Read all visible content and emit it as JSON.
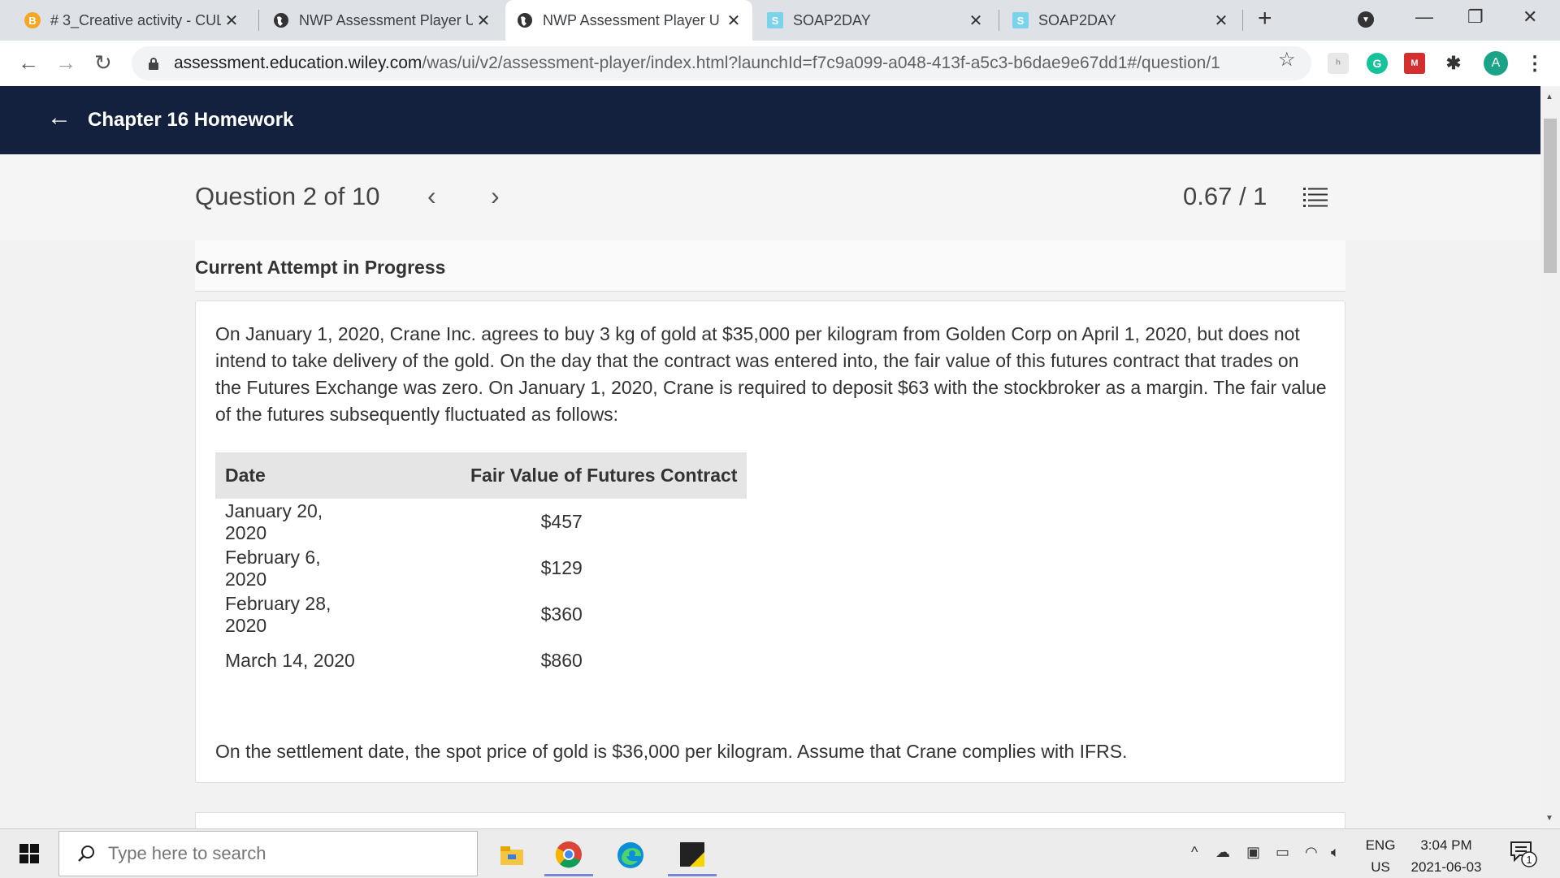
{
  "browser": {
    "tabs": [
      {
        "title": "# 3_Creative activity - CUL",
        "favicon": "b-badge-icon",
        "active": false
      },
      {
        "title": "NWP Assessment Player U",
        "favicon": "globe-icon",
        "active": false
      },
      {
        "title": "NWP Assessment Player U",
        "favicon": "globe-icon",
        "active": true
      },
      {
        "title": "SOAP2DAY",
        "favicon": "s-badge-icon",
        "active": false
      },
      {
        "title": "SOAP2DAY",
        "favicon": "s-badge-icon",
        "active": false
      }
    ],
    "favicon_letters": {
      "b": "B",
      "s": "S"
    },
    "close_glyph": "✕",
    "new_tab_glyph": "+",
    "url_host": "assessment.education.wiley.com",
    "url_path": "/was/ui/v2/assessment-player/index.html?launchId=f7c9a099-a048-413f-a5c3-b6dae9e67dd1#/question/1",
    "profile_initial": "A",
    "colors": {
      "tab_strip": "#dee1e6",
      "header": "#13213f",
      "grammarly": "#15c39a"
    }
  },
  "header": {
    "title": "Chapter 16 Homework"
  },
  "question_nav": {
    "label": "Question 2 of 10",
    "score": "0.67 / 1"
  },
  "content": {
    "attempt_label": "Current Attempt in Progress",
    "intro": "On January 1, 2020, Crane Inc. agrees to buy 3 kg of gold at $35,000 per kilogram from Golden Corp on April 1, 2020, but does not intend to take delivery of the gold. On the day that the contract was entered into, the fair value of this futures contract that trades on the Futures Exchange was zero. On January 1, 2020, Crane is required to deposit $63 with the stockbroker as a margin. The fair value of the futures subsequently fluctuated as follows:",
    "table": {
      "headers": [
        "Date",
        "Fair Value of Futures Contract"
      ],
      "rows": [
        [
          "January 20, 2020",
          "$457"
        ],
        [
          "February 6, 2020",
          "$129"
        ],
        [
          "February 28, 2020",
          "$360"
        ],
        [
          "March 14, 2020",
          "$860"
        ]
      ]
    },
    "closing": "On the settlement date, the spot price of gold is $36,000 per kilogram. Assume that Crane complies with IFRS."
  },
  "taskbar": {
    "search_placeholder": "Type here to search",
    "lang_line1": "ENG",
    "lang_line2": "US",
    "time": "3:04 PM",
    "date": "2021-06-03",
    "notification_count": "1"
  }
}
